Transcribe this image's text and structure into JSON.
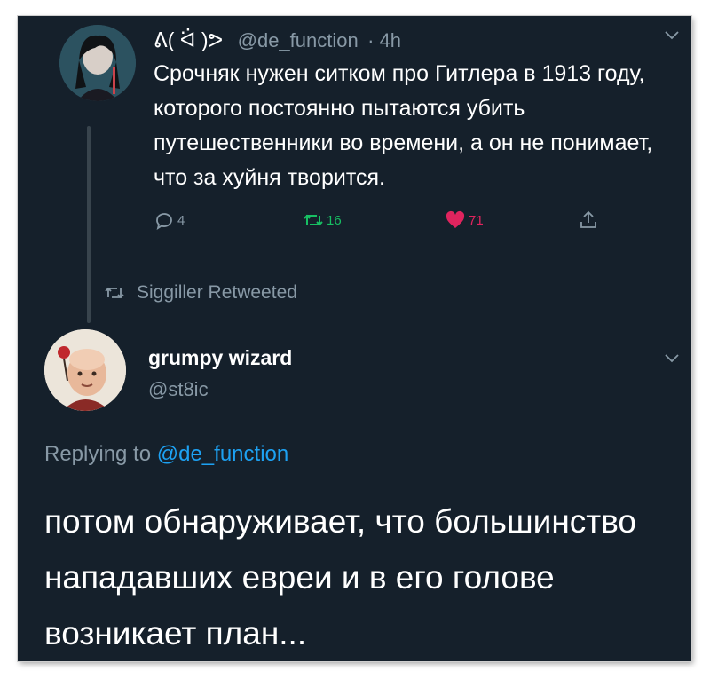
{
  "tweet1": {
    "display_name": "ᕕ( ᐛ )ᕗ",
    "handle": "@de_function",
    "time": "· 4h",
    "text": "Срочняк нужен ситком про Гитлера в 1913 году, которого постоянно пытаются убить путешественники во времени, а он не понимает, что за хуйня творится.",
    "replies": "4",
    "retweets": "16",
    "likes": "71",
    "icons": {
      "reply": "reply-icon",
      "retweet": "retweet-icon",
      "like": "heart-icon",
      "share": "share-icon",
      "menu": "chevron-down-icon"
    }
  },
  "retweet_context": {
    "label": "Siggiller Retweeted"
  },
  "tweet2": {
    "display_name": "grumpy wizard",
    "handle": "@st8ic",
    "replying_prefix": "Replying to",
    "replying_to": "@de_function",
    "text": "потом обнаруживает, что большинство нападавших евреи и в его голове возникает план..."
  },
  "colors": {
    "background": "#15202b",
    "text": "#ffffff",
    "muted": "#8899a6",
    "link": "#1da1f2",
    "retweet": "#17bf63",
    "like": "#e0245e"
  }
}
